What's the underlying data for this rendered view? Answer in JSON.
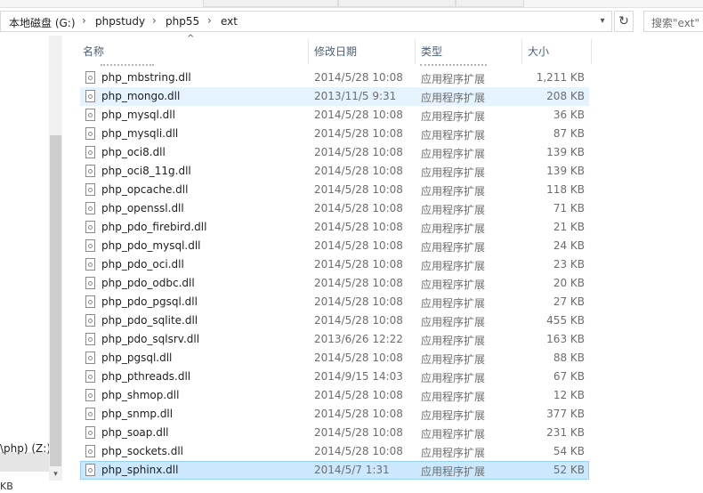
{
  "address": {
    "crumbs": [
      "本地磁盘 (G:)",
      "phpstudy",
      "php55",
      "ext"
    ],
    "search_placeholder": "搜索\"ext\""
  },
  "nav": {
    "drive_label": "\\php) (Z:)",
    "kb_label": "KB"
  },
  "columns": {
    "name": "名称",
    "date": "修改日期",
    "type": "类型",
    "size": "大小"
  },
  "files": [
    {
      "name": "php_mbstring.dll",
      "date": "2014/5/28 10:08",
      "type": "应用程序扩展",
      "size": "1,211 KB"
    },
    {
      "name": "php_mongo.dll",
      "date": "2013/11/5 9:31",
      "type": "应用程序扩展",
      "size": "208 KB"
    },
    {
      "name": "php_mysql.dll",
      "date": "2014/5/28 10:08",
      "type": "应用程序扩展",
      "size": "36 KB"
    },
    {
      "name": "php_mysqli.dll",
      "date": "2014/5/28 10:08",
      "type": "应用程序扩展",
      "size": "87 KB"
    },
    {
      "name": "php_oci8.dll",
      "date": "2014/5/28 10:08",
      "type": "应用程序扩展",
      "size": "139 KB"
    },
    {
      "name": "php_oci8_11g.dll",
      "date": "2014/5/28 10:08",
      "type": "应用程序扩展",
      "size": "139 KB"
    },
    {
      "name": "php_opcache.dll",
      "date": "2014/5/28 10:08",
      "type": "应用程序扩展",
      "size": "118 KB"
    },
    {
      "name": "php_openssl.dll",
      "date": "2014/5/28 10:08",
      "type": "应用程序扩展",
      "size": "71 KB"
    },
    {
      "name": "php_pdo_firebird.dll",
      "date": "2014/5/28 10:08",
      "type": "应用程序扩展",
      "size": "21 KB"
    },
    {
      "name": "php_pdo_mysql.dll",
      "date": "2014/5/28 10:08",
      "type": "应用程序扩展",
      "size": "24 KB"
    },
    {
      "name": "php_pdo_oci.dll",
      "date": "2014/5/28 10:08",
      "type": "应用程序扩展",
      "size": "23 KB"
    },
    {
      "name": "php_pdo_odbc.dll",
      "date": "2014/5/28 10:08",
      "type": "应用程序扩展",
      "size": "20 KB"
    },
    {
      "name": "php_pdo_pgsql.dll",
      "date": "2014/5/28 10:08",
      "type": "应用程序扩展",
      "size": "27 KB"
    },
    {
      "name": "php_pdo_sqlite.dll",
      "date": "2014/5/28 10:08",
      "type": "应用程序扩展",
      "size": "455 KB"
    },
    {
      "name": "php_pdo_sqlsrv.dll",
      "date": "2013/6/26 12:22",
      "type": "应用程序扩展",
      "size": "163 KB"
    },
    {
      "name": "php_pgsql.dll",
      "date": "2014/5/28 10:08",
      "type": "应用程序扩展",
      "size": "88 KB"
    },
    {
      "name": "php_pthreads.dll",
      "date": "2014/9/15 14:03",
      "type": "应用程序扩展",
      "size": "67 KB"
    },
    {
      "name": "php_shmop.dll",
      "date": "2014/5/28 10:08",
      "type": "应用程序扩展",
      "size": "12 KB"
    },
    {
      "name": "php_snmp.dll",
      "date": "2014/5/28 10:08",
      "type": "应用程序扩展",
      "size": "377 KB"
    },
    {
      "name": "php_soap.dll",
      "date": "2014/5/28 10:08",
      "type": "应用程序扩展",
      "size": "231 KB"
    },
    {
      "name": "php_sockets.dll",
      "date": "2014/5/28 10:08",
      "type": "应用程序扩展",
      "size": "54 KB"
    },
    {
      "name": "php_sphinx.dll",
      "date": "2014/5/7 1:31",
      "type": "应用程序扩展",
      "size": "52 KB"
    }
  ],
  "hovered_index": 1,
  "selected_index": 21
}
